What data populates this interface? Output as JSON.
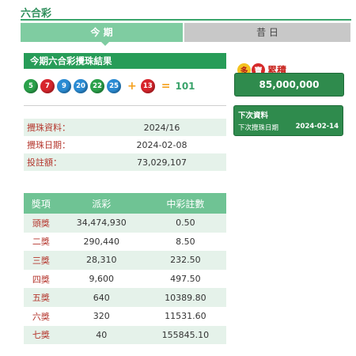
{
  "header": {
    "title": "六合彩"
  },
  "tabs": {
    "current": "今 期",
    "past": "昔 日"
  },
  "result": {
    "title": "今期六合彩攪珠結果",
    "balls": [
      {
        "num": "5",
        "color": "green"
      },
      {
        "num": "7",
        "color": "red"
      },
      {
        "num": "9",
        "color": "blue"
      },
      {
        "num": "20",
        "color": "blue"
      },
      {
        "num": "22",
        "color": "green"
      },
      {
        "num": "25",
        "color": "blue"
      }
    ],
    "plus": "+",
    "extra": {
      "num": "13",
      "color": "red"
    },
    "equals": "=",
    "total": "101"
  },
  "info": {
    "rows": [
      {
        "label": "攪珠資料：",
        "value": "2024/16"
      },
      {
        "label": "攪珠日期：",
        "value": "2024-02-08"
      },
      {
        "label": "投註額：",
        "value": "73,029,107"
      }
    ]
  },
  "prizes": {
    "headers": [
      "獎項",
      "派彩",
      "中彩註數"
    ],
    "rows": [
      {
        "name": "頭獎",
        "payout": "34,474,930",
        "winners": "0.50"
      },
      {
        "name": "二獎",
        "payout": "290,440",
        "winners": "8.50"
      },
      {
        "name": "三獎",
        "payout": "28,310",
        "winners": "232.50"
      },
      {
        "name": "四獎",
        "payout": "9,600",
        "winners": "497.50"
      },
      {
        "name": "五獎",
        "payout": "640",
        "winners": "10389.80"
      },
      {
        "name": "六獎",
        "payout": "320",
        "winners": "11531.60"
      },
      {
        "name": "七獎",
        "payout": "40",
        "winners": "155845.10"
      }
    ]
  },
  "jackpot": {
    "badge_chars": [
      "多",
      "寶"
    ],
    "badge_label": "累積",
    "amount": "85,000,000"
  },
  "next_draw": {
    "title": "下次資料",
    "date_label": "下次攪珠日期",
    "date": "2024-02-14"
  },
  "colors": {
    "green": "#2aa14a",
    "red": "#d7252c",
    "blue": "#2a8bd3",
    "accent": "#279c58"
  }
}
